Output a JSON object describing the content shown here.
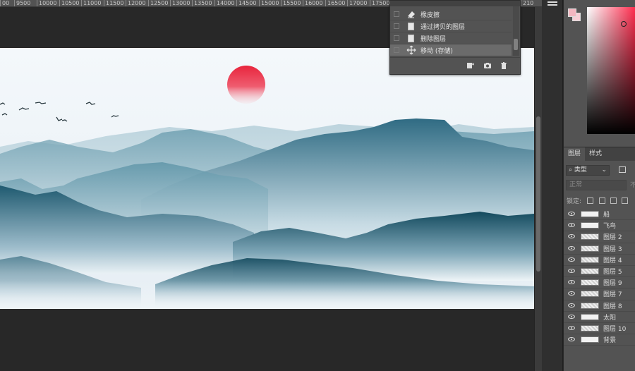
{
  "ruler": {
    "ticks": [
      "00",
      "9500",
      "10000",
      "10500",
      "11000",
      "11500",
      "12000",
      "12500",
      "13000",
      "13500",
      "14000",
      "14500",
      "15000",
      "15500",
      "16000",
      "16500",
      "17000",
      "17500",
      "210"
    ]
  },
  "history": {
    "items": [
      {
        "label": "橡皮擦",
        "icon": "eraser-icon"
      },
      {
        "label": "通过拷贝的图层",
        "icon": "document-icon"
      },
      {
        "label": "删除图层",
        "icon": "document-icon"
      },
      {
        "label": "移动 (存储)",
        "icon": "move-icon",
        "selected": true
      }
    ],
    "footer_icons": [
      "new-document-from-state-icon",
      "camera-snapshot-icon",
      "trash-icon"
    ]
  },
  "colors": {
    "foreground": "#f2b6c0",
    "background": "#f7cfd6",
    "hue": "#ff2e4f"
  },
  "layers_panel": {
    "tabs": [
      "图层",
      "样式"
    ],
    "filter_label": "类型",
    "blend_mode": "正常",
    "opacity_cut": "不",
    "lock_label": "锁定:",
    "layers": [
      {
        "name": "船",
        "thumb": "plain"
      },
      {
        "name": "飞鸟",
        "thumb": "plain"
      },
      {
        "name": "图层 2",
        "thumb": "pattern"
      },
      {
        "name": "图层 3",
        "thumb": "pattern"
      },
      {
        "name": "图层 4",
        "thumb": "pattern"
      },
      {
        "name": "图层 5",
        "thumb": "pattern"
      },
      {
        "name": "图层 9",
        "thumb": "pattern"
      },
      {
        "name": "图层 7",
        "thumb": "pattern"
      },
      {
        "name": "图层 8",
        "thumb": "pattern"
      },
      {
        "name": "太阳",
        "thumb": "plain"
      },
      {
        "name": "图层 10",
        "thumb": "pattern"
      },
      {
        "name": "背景",
        "thumb": "plain"
      }
    ]
  }
}
